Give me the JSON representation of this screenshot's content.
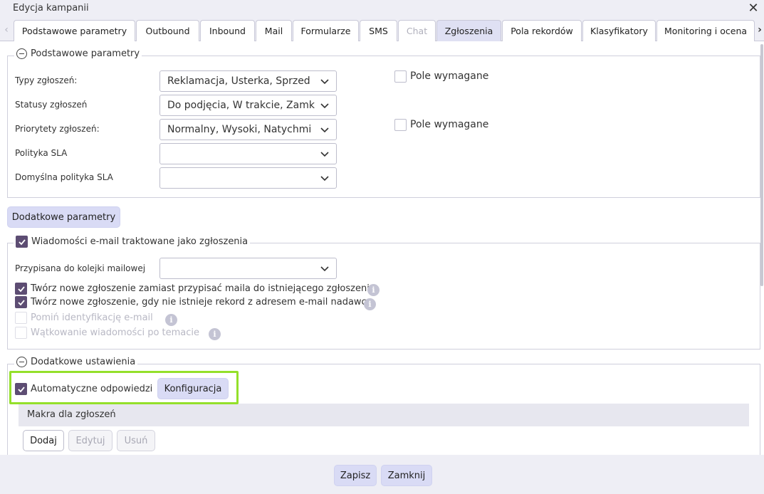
{
  "window": {
    "title": "Edycja kampanii"
  },
  "tabs": [
    {
      "label": "Podstawowe parametry",
      "state": "normal"
    },
    {
      "label": "Outbound",
      "state": "normal"
    },
    {
      "label": "Inbound",
      "state": "normal"
    },
    {
      "label": "Mail",
      "state": "normal"
    },
    {
      "label": "Formularze",
      "state": "normal"
    },
    {
      "label": "SMS",
      "state": "normal"
    },
    {
      "label": "Chat",
      "state": "disabled"
    },
    {
      "label": "Zgłoszenia",
      "state": "active"
    },
    {
      "label": "Pola rekordów",
      "state": "normal"
    },
    {
      "label": "Klasyfikatory",
      "state": "normal"
    },
    {
      "label": "Monitoring i ocena",
      "state": "normal"
    }
  ],
  "basic": {
    "legend": "Podstawowe parametry",
    "fields": [
      {
        "label": "Typy zgłoszeń:",
        "value": "Reklamacja, Usterka, Sprzed"
      },
      {
        "label": "Statusy zgłoszeń",
        "value": "Do podjęcia, W trakcie, Zamk"
      },
      {
        "label": "Priorytety zgłoszeń:",
        "value": "Normalny, Wysoki, Natychmi"
      },
      {
        "label": "Polityka SLA",
        "value": ""
      },
      {
        "label": "Domyślna polityka SLA",
        "value": ""
      }
    ],
    "required": [
      {
        "label": "Pole wymagane",
        "checked": false
      },
      {
        "label": "Pole wymagane",
        "checked": false
      }
    ]
  },
  "additional_params_button": "Dodatkowe parametry",
  "email": {
    "legend": "Wiadomości e-mail traktowane jako zgłoszenia",
    "legend_checked": true,
    "queue_label": "Przypisana do kolejki mailowej",
    "queue_value": "",
    "options": [
      {
        "label": "Twórz nowe zgłoszenie zamiast przypisać maila do istniejącego zgłoszenia",
        "checked": true,
        "disabled": false
      },
      {
        "label": "Twórz nowe zgłoszenie, gdy nie istnieje rekord z adresem e-mail nadawcy",
        "checked": true,
        "disabled": false
      },
      {
        "label": "Pomiń identyfikację e-mail",
        "checked": false,
        "disabled": true
      },
      {
        "label": "Wątkowanie wiadomości po temacie",
        "checked": false,
        "disabled": true
      }
    ],
    "info_glyph": "i"
  },
  "extra": {
    "legend": "Dodatkowe ustawienia",
    "auto_reply": {
      "label": "Automatyczne odpowiedzi",
      "checked": true
    },
    "config_button": "Konfiguracja",
    "macros": {
      "title": "Makra dla zgłoszeń",
      "add": "Dodaj",
      "edit": "Edytuj",
      "remove": "Usuń"
    }
  },
  "footer": {
    "save": "Zapisz",
    "close": "Zamknij"
  },
  "icons": {
    "close": "close-icon",
    "chevron": "chevron-down-icon",
    "collapse": "collapse-minus-icon",
    "info": "info-icon",
    "check": "check-icon"
  },
  "colors": {
    "accent": "#5d4d73",
    "button": "#d9dbf5",
    "active_tab": "#dfe0f3",
    "highlight": "#94e02a"
  }
}
